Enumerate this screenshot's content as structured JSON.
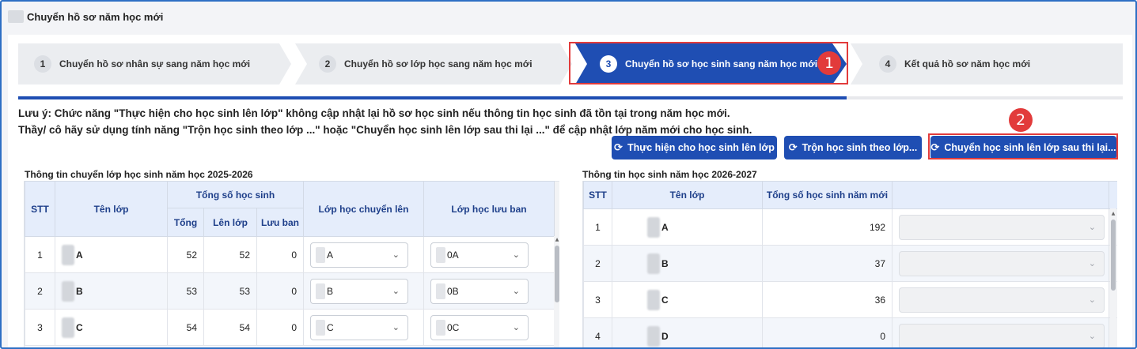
{
  "page_title": "Chuyển hồ sơ năm học mới",
  "steps": [
    {
      "num": "1",
      "label": "Chuyển hồ sơ nhân sự sang năm học mới"
    },
    {
      "num": "2",
      "label": "Chuyển hồ sơ lớp học sang năm học mới"
    },
    {
      "num": "3",
      "label": "Chuyển hồ sơ học sinh sang năm học mới"
    },
    {
      "num": "4",
      "label": "Kết quả hồ sơ năm học mới"
    }
  ],
  "active_step": 3,
  "progress_fraction": 0.75,
  "annotations": {
    "badge1": "1",
    "badge2": "2"
  },
  "note": {
    "line1": "Lưu ý: Chức năng \"Thực hiện cho học sinh lên lớp\" không cập nhật lại hồ sơ học sinh nếu thông tin học sinh đã tồn tại trong năm học mới.",
    "line2": "Thầy/ cô hãy sử dụng tính năng \"Trộn học sinh theo lớp ...\" hoặc \"Chuyển học sinh lên lớp sau thi lại ...\" để cập nhật lớp năm mới cho học sinh."
  },
  "buttons": {
    "promote": "Thực hiện cho học sinh lên lớp",
    "merge": "Trộn học sinh theo lớp...",
    "retake": "Chuyển học sinh lên lớp sau thi lại..."
  },
  "colors": {
    "primary": "#1f4eb3",
    "highlight": "#e23b3b",
    "header_bg": "#e5edfb"
  },
  "left_table": {
    "title": "Thông tin chuyển lớp học sinh năm học 2025-2026",
    "headers": {
      "stt": "STT",
      "class": "Tên lớp",
      "total_group": "Tổng số học sinh",
      "total": "Tổng",
      "promoted": "Lên lớp",
      "retained": "Lưu ban",
      "target_class": "Lớp học chuyển lên",
      "retained_class": "Lớp học lưu ban"
    },
    "rows": [
      {
        "stt": "1",
        "class": "A",
        "total": "52",
        "promoted": "52",
        "retained": "0",
        "target": "A",
        "retained_target": "0A"
      },
      {
        "stt": "2",
        "class": "B",
        "total": "53",
        "promoted": "53",
        "retained": "0",
        "target": "B",
        "retained_target": "0B"
      },
      {
        "stt": "3",
        "class": "C",
        "total": "54",
        "promoted": "54",
        "retained": "0",
        "target": "C",
        "retained_target": "0C"
      }
    ]
  },
  "right_table": {
    "title": "Thông tin học sinh năm học 2026-2027",
    "headers": {
      "stt": "STT",
      "class": "Tên lớp",
      "total": "Tổng số học sinh năm mới"
    },
    "rows": [
      {
        "stt": "1",
        "class": "A",
        "total": "192"
      },
      {
        "stt": "2",
        "class": "B",
        "total": "37"
      },
      {
        "stt": "3",
        "class": "C",
        "total": "36"
      },
      {
        "stt": "4",
        "class": "D",
        "total": "0"
      }
    ]
  }
}
